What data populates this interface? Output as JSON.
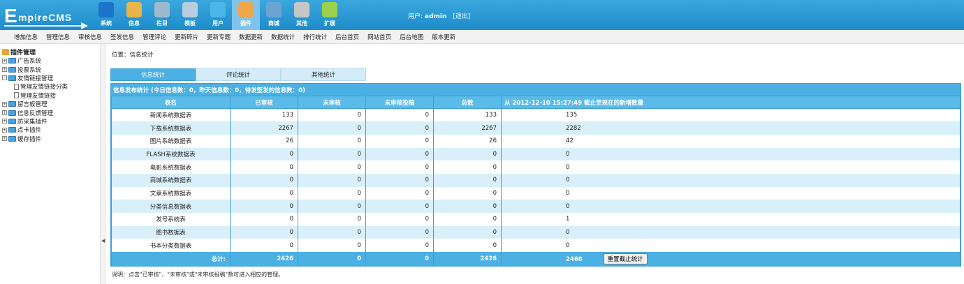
{
  "logo": {
    "first_letter": "E",
    "rest": "mpireCMS"
  },
  "topnav": [
    {
      "label": "系统",
      "icon": "globe-icon",
      "color": "#1d73c9"
    },
    {
      "label": "信息",
      "icon": "edit-icon",
      "color": "#e7b54a"
    },
    {
      "label": "栏目",
      "icon": "folder-icon",
      "color": "#9fb9cc"
    },
    {
      "label": "模板",
      "icon": "template-icon",
      "color": "#b9cde0"
    },
    {
      "label": "用户",
      "icon": "user-icon",
      "color": "#4bb7e8"
    },
    {
      "label": "插件",
      "icon": "plugin-icon",
      "color": "#f0a64a",
      "active": true
    },
    {
      "label": "商城",
      "icon": "shop-icon",
      "color": "#6ba4d4"
    },
    {
      "label": "其他",
      "icon": "gear-icon",
      "color": "#c6c6c6"
    },
    {
      "label": "扩展",
      "icon": "plus-icon",
      "color": "#9bd14c"
    }
  ],
  "user": {
    "prefix": "用户:",
    "name": "admin",
    "logout": "[退出]"
  },
  "subnav": [
    "增加信息",
    "管理信息",
    "审核信息",
    "签发信息",
    "管理评论",
    "更新碎片",
    "更新专题",
    "数据更新",
    "数据统计",
    "排行统计",
    "后台首页",
    "网站首页",
    "后台地图",
    "版本更新"
  ],
  "tree": {
    "root": "插件管理",
    "nodes": [
      {
        "label": "广告系统",
        "sign": "+"
      },
      {
        "label": "投票系统",
        "sign": "+"
      },
      {
        "label": "友情链接管理",
        "sign": "-",
        "children": [
          "管理友情链接分类",
          "管理友情链接"
        ]
      },
      {
        "label": "留言板管理",
        "sign": "+"
      },
      {
        "label": "信息反馈管理",
        "sign": "+"
      },
      {
        "label": "防采集插件",
        "sign": "+"
      },
      {
        "label": "点卡插件",
        "sign": "+"
      },
      {
        "label": "缓存插件",
        "sign": "+"
      }
    ]
  },
  "breadcrumb": "位置：信息统计",
  "tabs": [
    "信息统计",
    "评论统计",
    "其他统计"
  ],
  "table": {
    "caption": "信息发布统计 (今日信息数：0，昨天信息数：0，待发签发的信息数：0)",
    "headers": [
      "表名",
      "已审核",
      "未审核",
      "未审核投稿",
      "总数",
      "从 2012-12-10 15:27:49 截止至现在的新增数量"
    ],
    "rows": [
      [
        "新闻系统数据表",
        "133",
        "0",
        "0",
        "133",
        "135"
      ],
      [
        "下载系统数据表",
        "2267",
        "0",
        "0",
        "2267",
        "2282"
      ],
      [
        "图片系统数据表",
        "26",
        "0",
        "0",
        "26",
        "42"
      ],
      [
        "FLASH系统数据表",
        "0",
        "0",
        "0",
        "0",
        "0"
      ],
      [
        "电影系统数据表",
        "0",
        "0",
        "0",
        "0",
        "0"
      ],
      [
        "商城系统数据表",
        "0",
        "0",
        "0",
        "0",
        "0"
      ],
      [
        "文章系统数据表",
        "0",
        "0",
        "0",
        "0",
        "0"
      ],
      [
        "分类信息数据表",
        "0",
        "0",
        "0",
        "0",
        "0"
      ],
      [
        "发号系统表",
        "0",
        "0",
        "0",
        "0",
        "1"
      ],
      [
        "图书数据表",
        "0",
        "0",
        "0",
        "0",
        "0"
      ],
      [
        "书本分类数据表",
        "0",
        "0",
        "0",
        "0",
        "0"
      ]
    ],
    "total": [
      "总计:",
      "2426",
      "0",
      "0",
      "2426",
      "2460"
    ],
    "reset_button": "重置截止统计"
  },
  "note": "说明：点击\"已审核\"、\"未审核\"或\"未审核投稿\"数可进入相应的管理。"
}
